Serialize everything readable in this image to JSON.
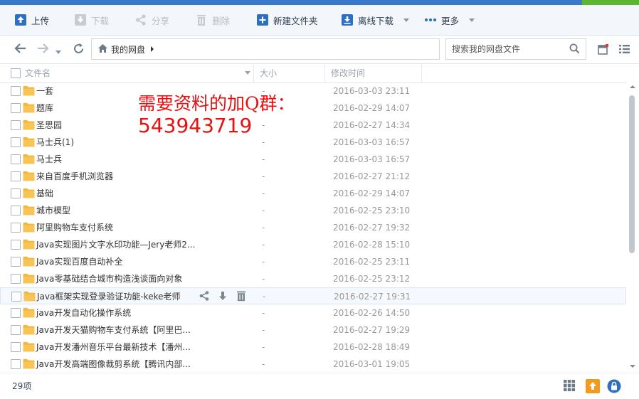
{
  "toolbar": {
    "upload": "上传",
    "download": "下载",
    "share": "分享",
    "delete": "删除",
    "new_folder": "新建文件夹",
    "offline_download": "离线下载",
    "more": "更多"
  },
  "nav": {
    "breadcrumb": "我的网盘",
    "search_placeholder": "搜索我的网盘文件"
  },
  "columns": {
    "name": "文件名",
    "size": "大小",
    "modified": "修改时间"
  },
  "annotation": {
    "line1": "需要资料的加Q群：",
    "line2": "543943719"
  },
  "files": [
    {
      "name": "一套",
      "size": "-",
      "modified": "2016-03-03 23:11"
    },
    {
      "name": "题库",
      "size": "-",
      "modified": "2016-02-29 14:07"
    },
    {
      "name": "圣思园",
      "size": "-",
      "modified": "2016-02-27 14:34"
    },
    {
      "name": "马士兵(1)",
      "size": "-",
      "modified": "2016-03-03 16:57"
    },
    {
      "name": "马士兵",
      "size": "-",
      "modified": "2016-03-03 16:57"
    },
    {
      "name": "来自百度手机浏览器",
      "size": "-",
      "modified": "2016-02-27 21:12"
    },
    {
      "name": "基础",
      "size": "-",
      "modified": "2016-02-29 14:07"
    },
    {
      "name": "城市模型",
      "size": "-",
      "modified": "2016-02-25 23:10"
    },
    {
      "name": "阿里购物车支付系统",
      "size": "-",
      "modified": "2016-02-27 19:32"
    },
    {
      "name": "Java实现图片文字水印功能—Jery老师2...",
      "size": "-",
      "modified": "2016-02-28 15:10"
    },
    {
      "name": "Java实现百度自动补全",
      "size": "-",
      "modified": "2016-02-25 23:11"
    },
    {
      "name": "Java零基础结合城市构造浅谈面向对象",
      "size": "-",
      "modified": "2016-02-25 23:12"
    },
    {
      "name": "Java框架实现登录验证功能-keke老师",
      "size": "-",
      "modified": "2016-02-27 19:31"
    },
    {
      "name": "java开发自动化操作系统",
      "size": "-",
      "modified": "2016-02-26 14:50"
    },
    {
      "name": "Java开发天猫购物车支付系统【阿里巴...",
      "size": "-",
      "modified": "2016-02-27 19:29"
    },
    {
      "name": "Java开发潘州音乐平台最新技术【潘州...",
      "size": "-",
      "modified": "2016-02-28 18:49"
    },
    {
      "name": "Java开发高端图像裁剪系统【腾讯内部...",
      "size": "-",
      "modified": "2016-03-01 19:05"
    }
  ],
  "hover_row_index": 12,
  "status": {
    "count": "29项"
  },
  "colors": {
    "accent": "#3a78c9",
    "folder": "#f5b73b",
    "annotation": "#e81010"
  }
}
